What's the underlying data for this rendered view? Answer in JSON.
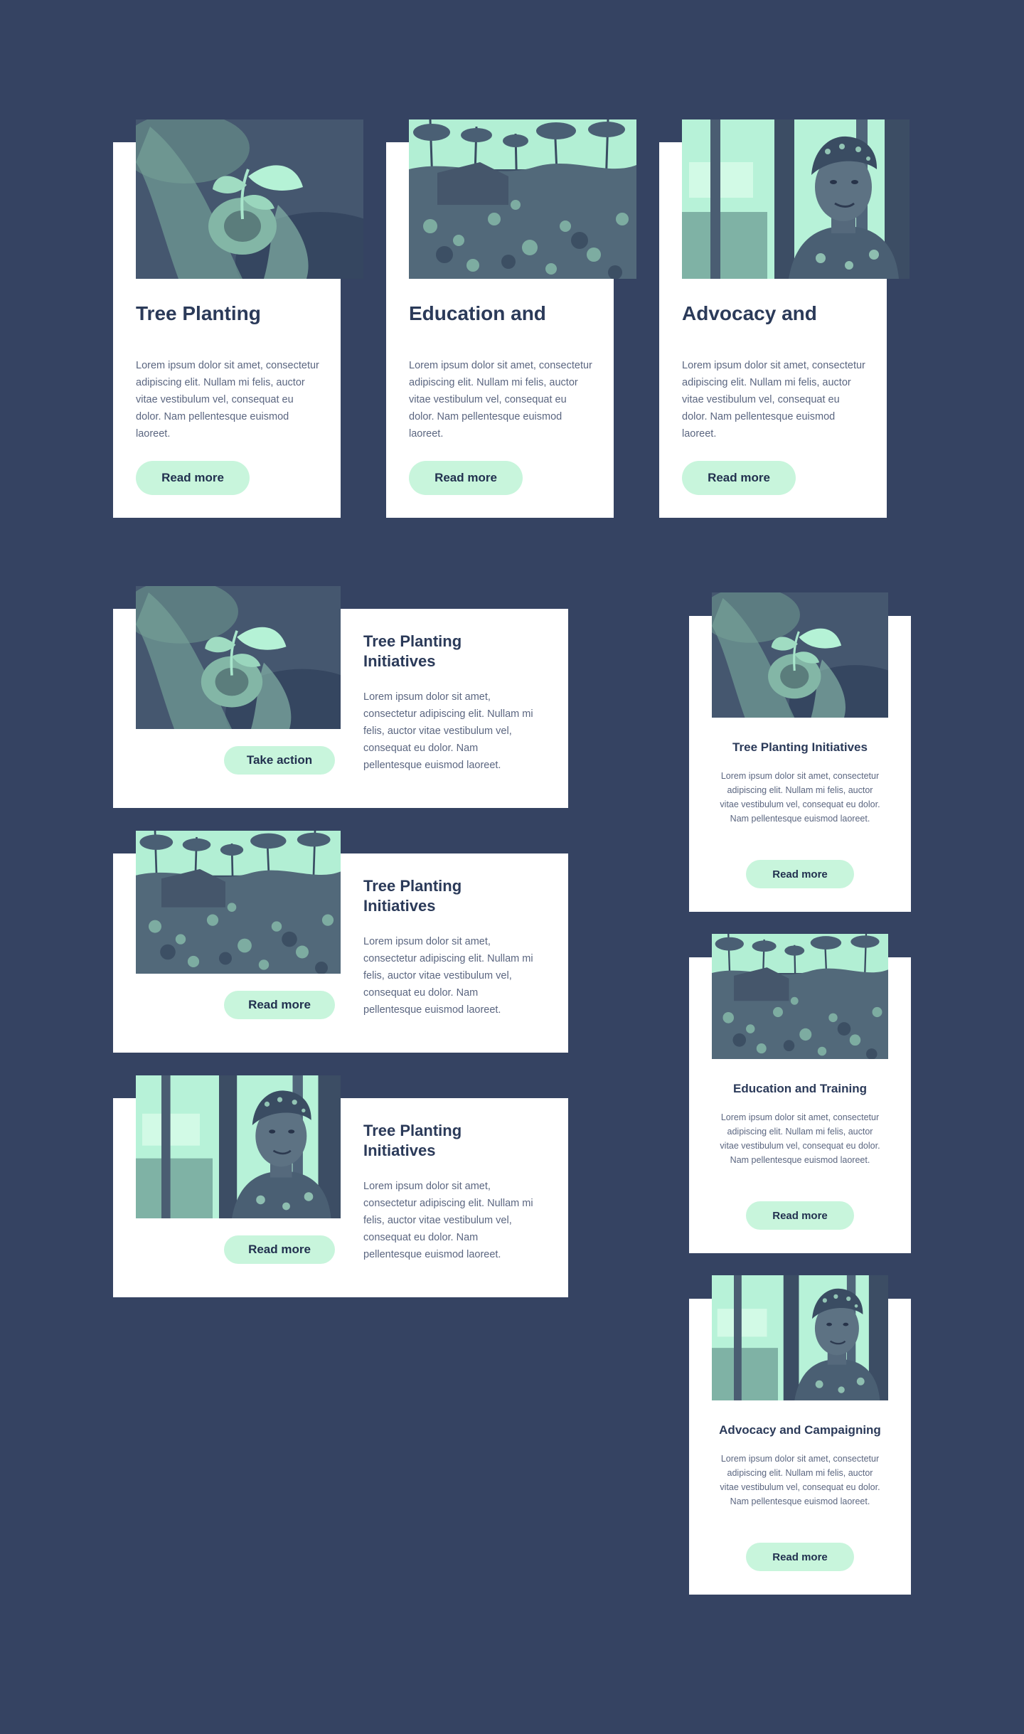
{
  "colors": {
    "background": "#354362",
    "card": "#ffffff",
    "accent": "#c8f5dc",
    "title": "#2b3a59",
    "body_text": "#5b6680"
  },
  "tall_cards": [
    {
      "photo": "seedling-in-hands-image",
      "title": "Tree Planting",
      "body": "Lorem ipsum dolor sit amet, consectetur adipiscing elit. Nullam mi felis, auctor vitae vestibulum vel, consequat eu dolor. Nam pellentesque euismod laoreet.",
      "button": "Read more"
    },
    {
      "photo": "cleared-forest-image",
      "title": "Education and",
      "body": "Lorem ipsum dolor sit amet, consectetur adipiscing elit. Nullam mi felis, auctor vitae vestibulum vel, consequat eu dolor. Nam pellentesque euismod laoreet.",
      "button": "Read more"
    },
    {
      "photo": "woman-portrait-image",
      "title": "Advocacy and",
      "body": "Lorem ipsum dolor sit amet, consectetur adipiscing elit. Nullam mi felis, auctor vitae vestibulum vel, consequat eu dolor. Nam pellentesque euismod laoreet.",
      "button": "Read more"
    }
  ],
  "horizontal_cards": [
    {
      "photo": "seedling-in-hands-image",
      "title": "Tree Planting Initiatives",
      "body": "Lorem ipsum dolor sit amet, consectetur adipiscing elit. Nullam mi felis, auctor vitae vestibulum vel, consequat eu dolor. Nam pellentesque euismod laoreet.",
      "button": "Take action"
    },
    {
      "photo": "cleared-forest-image",
      "title": "Tree Planting Initiatives",
      "body": "Lorem ipsum dolor sit amet, consectetur adipiscing elit. Nullam mi felis, auctor vitae vestibulum vel, consequat eu dolor. Nam pellentesque euismod laoreet.",
      "button": "Read more"
    },
    {
      "photo": "woman-portrait-image",
      "title": "Tree Planting Initiatives",
      "body": "Lorem ipsum dolor sit amet, consectetur adipiscing elit. Nullam mi felis, auctor vitae vestibulum vel, consequat eu dolor. Nam pellentesque euismod laoreet.",
      "button": "Read more"
    }
  ],
  "small_cards": [
    {
      "photo": "seedling-in-hands-image",
      "title": "Tree Planting Initiatives",
      "body": "Lorem ipsum dolor sit amet, consectetur adipiscing elit. Nullam mi felis, auctor vitae vestibulum vel, consequat eu dolor. Nam pellentesque euismod laoreet.",
      "button": "Read more"
    },
    {
      "photo": "cleared-forest-image",
      "title": "Education and Training",
      "body": "Lorem ipsum dolor sit amet, consectetur adipiscing elit. Nullam mi felis, auctor vitae vestibulum vel, consequat eu dolor. Nam pellentesque euismod laoreet.",
      "button": "Read more"
    },
    {
      "photo": "woman-portrait-image",
      "title": "Advocacy and Campaigning",
      "body": "Lorem ipsum dolor sit amet, consectetur adipiscing elit. Nullam mi felis, auctor vitae vestibulum vel, consequat eu dolor. Nam pellentesque euismod laoreet.",
      "button": "Read more"
    }
  ]
}
